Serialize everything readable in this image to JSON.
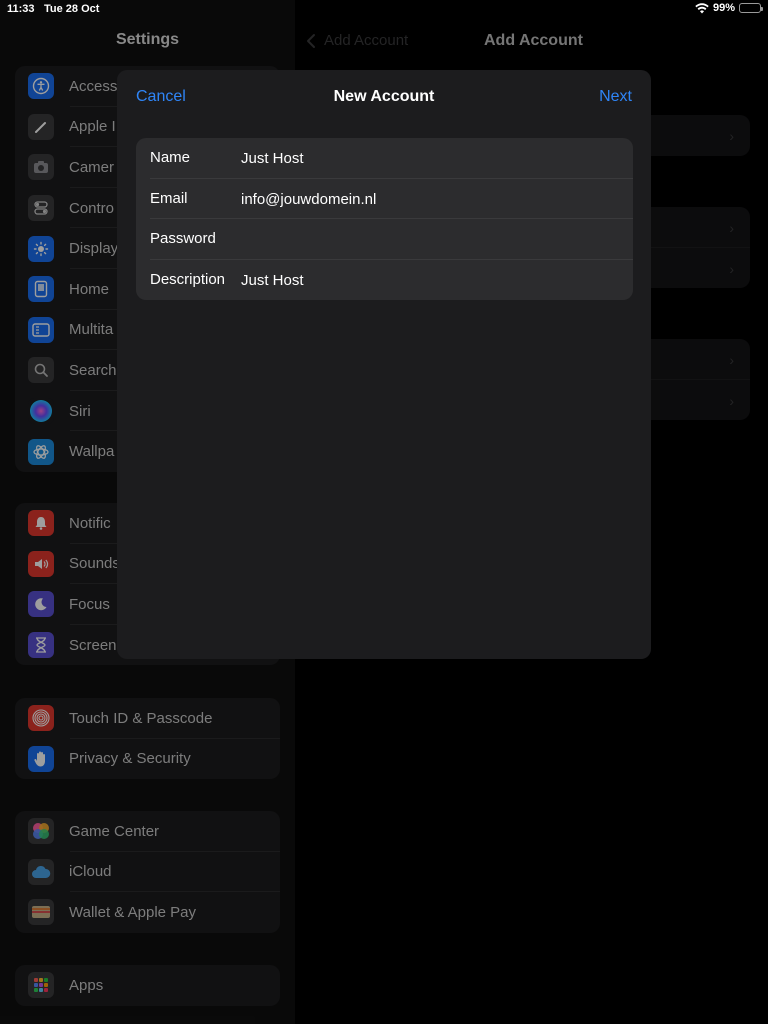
{
  "status": {
    "time": "11:33",
    "date": "Tue 28 Oct",
    "battery": "99%"
  },
  "sidebar": {
    "title": "Settings",
    "groups": [
      {
        "items": [
          {
            "label": "Access",
            "icon": "accessibility-icon",
            "color": "#1a6ff0"
          },
          {
            "label": "Apple I",
            "icon": "apple-pencil-icon",
            "color": "#3a3a3c"
          },
          {
            "label": "Camer",
            "icon": "camera-icon",
            "color": "#3a3a3c"
          },
          {
            "label": "Contro",
            "icon": "control-centre-icon",
            "color": "#3a3a3c"
          },
          {
            "label": "Display",
            "icon": "display-brightness-icon",
            "color": "#1a6ff0"
          },
          {
            "label": "Home",
            "icon": "home-screen-icon",
            "color": "#1a6ff0"
          },
          {
            "label": "Multita",
            "icon": "multitasking-icon",
            "color": "#1a6ff0"
          },
          {
            "label": "Search",
            "icon": "search-icon",
            "color": "#3a3a3c"
          },
          {
            "label": "Siri",
            "icon": "siri-icon",
            "color": "#2a2a5a"
          },
          {
            "label": "Wallpa",
            "icon": "wallpaper-icon",
            "color": "#1c8cdc"
          }
        ]
      },
      {
        "items": [
          {
            "label": "Notific",
            "icon": "notifications-icon",
            "color": "#e0382e"
          },
          {
            "label": "Sounds",
            "icon": "sounds-icon",
            "color": "#e0382e"
          },
          {
            "label": "Focus",
            "icon": "focus-moon-icon",
            "color": "#5a4fd0"
          },
          {
            "label": "Screen",
            "icon": "screen-time-icon",
            "color": "#5a4fd0"
          }
        ]
      },
      {
        "items": [
          {
            "label": "Touch ID & Passcode",
            "icon": "fingerprint-icon",
            "color": "#e0382e"
          },
          {
            "label": "Privacy & Security",
            "icon": "hand-icon",
            "color": "#1a6ff0"
          }
        ]
      },
      {
        "items": [
          {
            "label": "Game Center",
            "icon": "game-center-icon",
            "color": "#3a3a3c"
          },
          {
            "label": "iCloud",
            "icon": "icloud-icon",
            "color": "#3a3a3c"
          },
          {
            "label": "Wallet & Apple Pay",
            "icon": "wallet-icon",
            "color": "#3a3a3c"
          }
        ]
      },
      {
        "items": [
          {
            "label": "Apps",
            "icon": "apps-grid-icon",
            "color": "#3a3a3c"
          }
        ]
      }
    ]
  },
  "detail": {
    "back_label": "Add Account",
    "title": "Add Account"
  },
  "modal": {
    "title": "New Account",
    "cancel_label": "Cancel",
    "next_label": "Next",
    "fields": [
      {
        "label": "Name",
        "value": "Just Host",
        "placeholder": ""
      },
      {
        "label": "Email",
        "value": "info@jouwdomein.nl",
        "placeholder": ""
      },
      {
        "label": "Password",
        "value": "",
        "placeholder": ""
      },
      {
        "label": "Description",
        "value": "Just Host",
        "placeholder": ""
      }
    ]
  },
  "colors": {
    "accent": "#2f85f7",
    "background": "#000000",
    "card": "#1c1c1e",
    "form": "#2c2c2e"
  }
}
